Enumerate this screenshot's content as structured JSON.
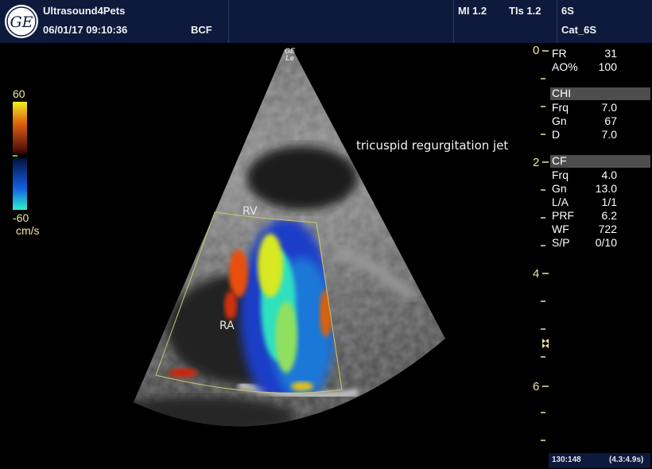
{
  "header": {
    "brand": "Ultrasound4Pets",
    "datetime": "06/01/17 09:10:36",
    "code": "BCF",
    "mi": "MI 1.2",
    "tis": "TIs 1.2",
    "probe": "6S",
    "preset": "Cat_6S",
    "logo_text": "GE"
  },
  "probe_mark": {
    "line1": "GE",
    "line2": "Le"
  },
  "color_scale": {
    "max": "60",
    "min": "-60",
    "unit": "cm/s"
  },
  "depth_marks": [
    "0",
    "2",
    "4",
    "6"
  ],
  "annotation": "tricuspid regurgitation jet",
  "labels": {
    "rv": "RV",
    "ra": "RA"
  },
  "params_top": [
    {
      "name": "FR",
      "value": "31"
    },
    {
      "name": "AO%",
      "value": "100"
    }
  ],
  "chi": {
    "title": "CHI",
    "items": [
      {
        "name": "Frq",
        "value": "7.0"
      },
      {
        "name": "Gn",
        "value": "67"
      },
      {
        "name": "D",
        "value": "7.0"
      }
    ]
  },
  "cf": {
    "title": "CF",
    "items": [
      {
        "name": "Frq",
        "value": "4.0"
      },
      {
        "name": "Gn",
        "value": "13.0"
      },
      {
        "name": "L/A",
        "value": "1/1"
      },
      {
        "name": "PRF",
        "value": "6.2"
      },
      {
        "name": "WF",
        "value": "722"
      },
      {
        "name": "S/P",
        "value": "0/10"
      }
    ]
  },
  "footer": {
    "frame": "130:148",
    "time": "(4.3:4.9s)"
  },
  "colors": {
    "header_bg": "#0d1a3c",
    "depth_text": "#f0e6a0",
    "section_bar": "#4d4d4d"
  }
}
